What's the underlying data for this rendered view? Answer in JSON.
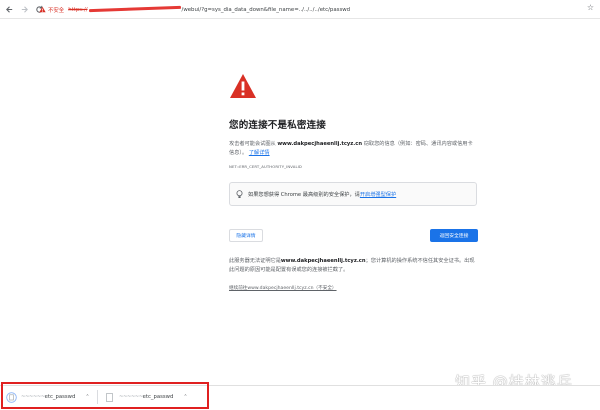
{
  "addressbar": {
    "insecure_label": "不安全",
    "scheme": "https://",
    "path": "/webui/?g=sys_dia_data_down&file_name=../../../../etc/passwd"
  },
  "page": {
    "title": "您的连接不是私密连接",
    "desc_prefix": "攻击者可能会试图从",
    "domain": "www.dakpecjhaeenllj.tcyz.cn",
    "desc_suffix": "窃取您的信息（例如：密码、通讯内容或信用卡信息）。",
    "learn_more": "了解详情",
    "error_code": "NET::ERR_CERT_AUTHORITY_INVALID",
    "enhanced_text": "如果您想获得 Chrome 最高级别的安全保护，请",
    "enhanced_link": "开启增强型保护",
    "details_button": "隐藏详情",
    "back_button": "返回安全连接",
    "details_prefix": "此服务器无法证明它是",
    "details_domain": "www.dakpecjhaeenllj.tcyz.cn",
    "details_suffix": "；您计算机的操作系统不信任其安全证书。出现此问题的原因可能是配置有误或您的连接被拦截了。",
    "proceed_link": "继续前往www.dakpecjhaeenllj.tcyz.cn（不安全）"
  },
  "watermark": "知乎 @桂林逃兵",
  "downloads": [
    {
      "squiggle": "~~~~~~",
      "name": "etc_passwd"
    },
    {
      "squiggle": "~~~~~~",
      "name": "etc_passwd"
    }
  ],
  "colors": {
    "danger": "#d93025",
    "link": "#1a73e8",
    "highlight": "#e02020"
  }
}
